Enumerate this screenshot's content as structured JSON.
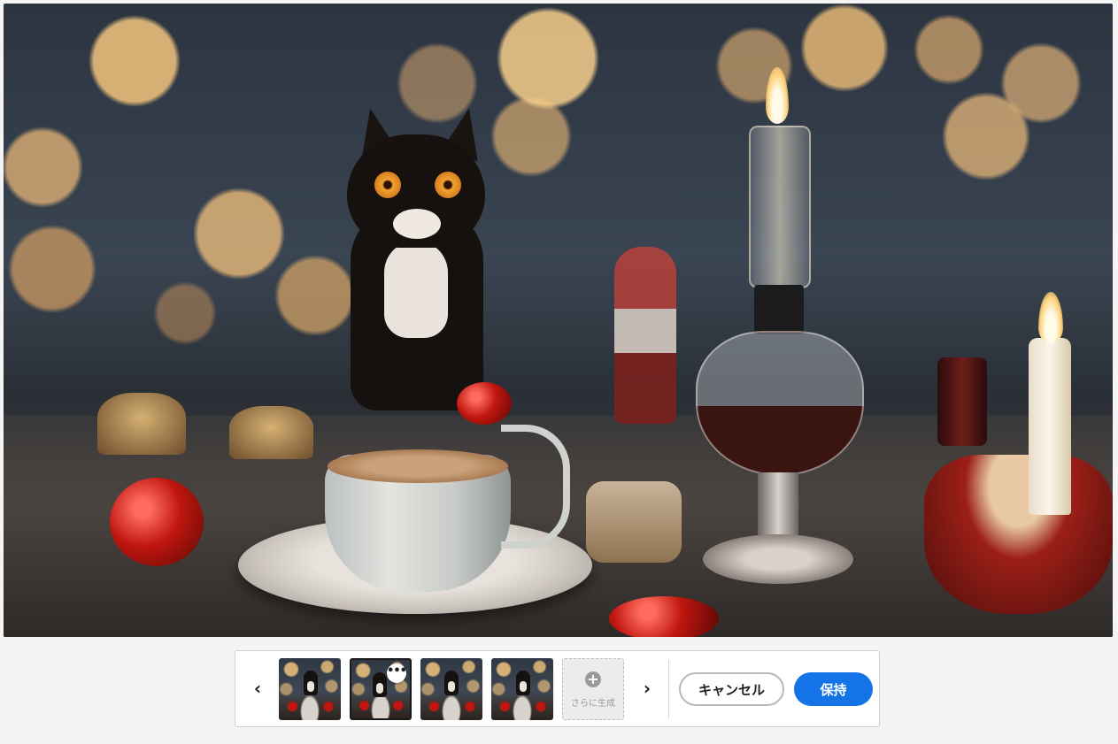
{
  "main_image": {
    "alt": ""
  },
  "variations": {
    "prev_label": "‹",
    "next_label": "›",
    "more_options_label": "•••",
    "selected_index": 1,
    "thumbnail_count": 4,
    "generate_more": {
      "icon": "plus-circle-icon",
      "label": "さらに生成"
    }
  },
  "actions": {
    "cancel_label": "キャンセル",
    "keep_label": "保持"
  },
  "colors": {
    "accent": "#1473e6",
    "background": "#f4f4f4"
  }
}
